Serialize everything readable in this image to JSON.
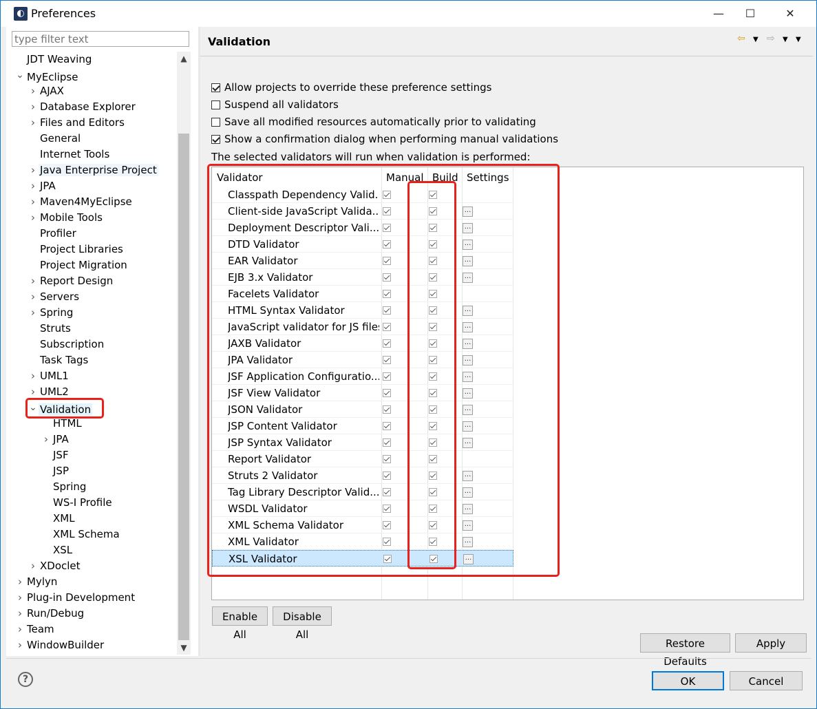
{
  "window": {
    "title": "Preferences",
    "minimize_glyph": "—",
    "maximize_glyph": "☐",
    "close_glyph": "✕"
  },
  "filter": {
    "placeholder": "type filter text"
  },
  "tree": [
    {
      "label": "JDT Weaving",
      "level": 0,
      "twisty": ""
    },
    {
      "label": "MyEclipse",
      "level": 0,
      "twisty": "expanded"
    },
    {
      "label": "AJAX",
      "level": 1,
      "twisty": "collapsed"
    },
    {
      "label": "Database Explorer",
      "level": 1,
      "twisty": "collapsed"
    },
    {
      "label": "Files and Editors",
      "level": 1,
      "twisty": "collapsed"
    },
    {
      "label": "General",
      "level": 1,
      "twisty": ""
    },
    {
      "label": "Internet Tools",
      "level": 1,
      "twisty": ""
    },
    {
      "label": "Java Enterprise Project",
      "level": 1,
      "twisty": "collapsed",
      "highlight": true
    },
    {
      "label": "JPA",
      "level": 1,
      "twisty": "collapsed"
    },
    {
      "label": "Maven4MyEclipse",
      "level": 1,
      "twisty": "collapsed"
    },
    {
      "label": "Mobile Tools",
      "level": 1,
      "twisty": "collapsed"
    },
    {
      "label": "Profiler",
      "level": 1,
      "twisty": ""
    },
    {
      "label": "Project Libraries",
      "level": 1,
      "twisty": ""
    },
    {
      "label": "Project Migration",
      "level": 1,
      "twisty": ""
    },
    {
      "label": "Report Design",
      "level": 1,
      "twisty": "collapsed"
    },
    {
      "label": "Servers",
      "level": 1,
      "twisty": "collapsed"
    },
    {
      "label": "Spring",
      "level": 1,
      "twisty": "collapsed"
    },
    {
      "label": "Struts",
      "level": 1,
      "twisty": ""
    },
    {
      "label": "Subscription",
      "level": 1,
      "twisty": ""
    },
    {
      "label": "Task Tags",
      "level": 1,
      "twisty": ""
    },
    {
      "label": "UML1",
      "level": 1,
      "twisty": "collapsed"
    },
    {
      "label": "UML2",
      "level": 1,
      "twisty": "collapsed"
    },
    {
      "label": "Validation",
      "level": 1,
      "twisty": "expanded",
      "selected": true
    },
    {
      "label": "HTML",
      "level": 2,
      "twisty": ""
    },
    {
      "label": "JPA",
      "level": 2,
      "twisty": "collapsed"
    },
    {
      "label": "JSF",
      "level": 2,
      "twisty": ""
    },
    {
      "label": "JSP",
      "level": 2,
      "twisty": ""
    },
    {
      "label": "Spring",
      "level": 2,
      "twisty": ""
    },
    {
      "label": "WS-I Profile",
      "level": 2,
      "twisty": ""
    },
    {
      "label": "XML",
      "level": 2,
      "twisty": ""
    },
    {
      "label": "XML Schema",
      "level": 2,
      "twisty": ""
    },
    {
      "label": "XSL",
      "level": 2,
      "twisty": ""
    },
    {
      "label": "XDoclet",
      "level": 1,
      "twisty": "collapsed"
    },
    {
      "label": "Mylyn",
      "level": 0,
      "twisty": "collapsed"
    },
    {
      "label": "Plug-in Development",
      "level": 0,
      "twisty": "collapsed"
    },
    {
      "label": "Run/Debug",
      "level": 0,
      "twisty": "collapsed"
    },
    {
      "label": "Team",
      "level": 0,
      "twisty": "collapsed"
    },
    {
      "label": "WindowBuilder",
      "level": 0,
      "twisty": "collapsed"
    }
  ],
  "page": {
    "title": "Validation",
    "options": [
      {
        "label": "Allow projects to override these preference settings",
        "checked": true
      },
      {
        "label": "Suspend all validators",
        "checked": false
      },
      {
        "label": "Save all modified resources automatically prior to validating",
        "checked": false
      },
      {
        "label": "Show a confirmation dialog when performing manual validations",
        "checked": true
      }
    ],
    "description": "The selected validators will run when validation is performed:",
    "columns": {
      "validator": "Validator",
      "manual": "Manual",
      "build": "Build",
      "settings": "Settings"
    },
    "settings_glyph": "...",
    "validators": [
      {
        "name": "Classpath Dependency Valid...",
        "manual": true,
        "build": true,
        "settings": false
      },
      {
        "name": "Client-side JavaScript Valida...",
        "manual": true,
        "build": true,
        "settings": true
      },
      {
        "name": "Deployment Descriptor Vali...",
        "manual": true,
        "build": true,
        "settings": true
      },
      {
        "name": "DTD Validator",
        "manual": true,
        "build": true,
        "settings": true
      },
      {
        "name": "EAR Validator",
        "manual": true,
        "build": true,
        "settings": true
      },
      {
        "name": "EJB 3.x Validator",
        "manual": true,
        "build": true,
        "settings": true
      },
      {
        "name": "Facelets Validator",
        "manual": true,
        "build": true,
        "settings": false
      },
      {
        "name": "HTML Syntax Validator",
        "manual": true,
        "build": true,
        "settings": true
      },
      {
        "name": "JavaScript validator for JS files",
        "manual": true,
        "build": true,
        "settings": true
      },
      {
        "name": "JAXB Validator",
        "manual": true,
        "build": true,
        "settings": true
      },
      {
        "name": "JPA Validator",
        "manual": true,
        "build": true,
        "settings": true
      },
      {
        "name": "JSF Application Configuratio...",
        "manual": true,
        "build": true,
        "settings": true
      },
      {
        "name": "JSF View Validator",
        "manual": true,
        "build": true,
        "settings": true
      },
      {
        "name": "JSON Validator",
        "manual": true,
        "build": true,
        "settings": true
      },
      {
        "name": "JSP Content Validator",
        "manual": true,
        "build": true,
        "settings": true
      },
      {
        "name": "JSP Syntax Validator",
        "manual": true,
        "build": true,
        "settings": true
      },
      {
        "name": "Report Validator",
        "manual": true,
        "build": true,
        "settings": false
      },
      {
        "name": "Struts 2 Validator",
        "manual": true,
        "build": true,
        "settings": true
      },
      {
        "name": "Tag Library Descriptor Valid...",
        "manual": true,
        "build": true,
        "settings": true
      },
      {
        "name": "WSDL Validator",
        "manual": true,
        "build": true,
        "settings": true
      },
      {
        "name": "XML Schema Validator",
        "manual": true,
        "build": true,
        "settings": true
      },
      {
        "name": "XML Validator",
        "manual": true,
        "build": true,
        "settings": true
      },
      {
        "name": "XSL Validator",
        "manual": true,
        "build": true,
        "settings": true,
        "selected": true
      }
    ],
    "enable_all": "Enable All",
    "disable_all": "Disable All",
    "restore_defaults": "Restore Defaults",
    "apply": "Apply"
  },
  "footer": {
    "help_glyph": "?",
    "ok": "OK",
    "cancel": "Cancel"
  },
  "annotation_color": "#e8221b"
}
